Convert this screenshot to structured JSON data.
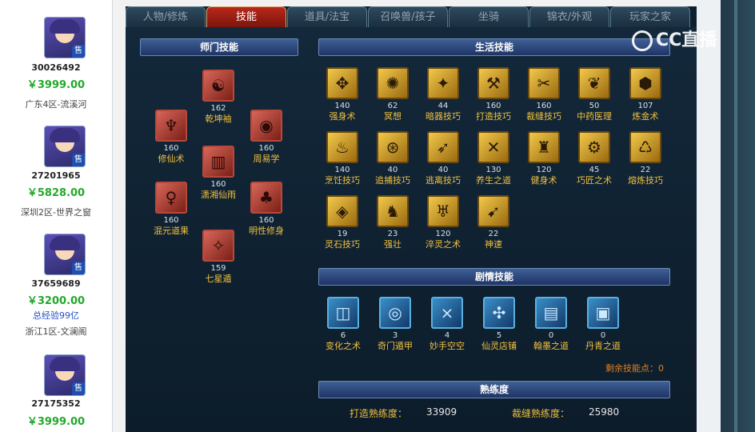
{
  "sidebar": {
    "listings": [
      {
        "id": "30026492",
        "price": "￥3999.00",
        "note": "",
        "server": "广东4区-流溪河",
        "tag": "售"
      },
      {
        "id": "27201965",
        "price": "￥5828.00",
        "note": "",
        "server": "深圳2区-世界之窗",
        "tag": "售"
      },
      {
        "id": "37659689",
        "price": "￥3200.00",
        "note": "总经验99亿",
        "server": "浙江1区-文澜阁",
        "tag": "售"
      },
      {
        "id": "27175352",
        "price": "￥3999.00",
        "note": "",
        "server": "",
        "tag": "售"
      }
    ]
  },
  "tabs": [
    "人物/修炼",
    "技能",
    "道具/法宝",
    "召唤兽/孩子",
    "坐骑",
    "锦衣/外观",
    "玩家之家"
  ],
  "active_tab": "技能",
  "sections": {
    "master": "师门技能",
    "life": "生活技能",
    "plot": "剧情技能",
    "proficiency": "熟练度"
  },
  "master_skills": [
    {
      "name": "乾坤袖",
      "level": "162",
      "glyph": "☯"
    },
    {
      "name": "修仙术",
      "level": "160",
      "glyph": "♆"
    },
    {
      "name": "周易学",
      "level": "160",
      "glyph": "◉"
    },
    {
      "name": "潇湘仙雨",
      "level": "160",
      "glyph": "▥"
    },
    {
      "name": "混元道果",
      "level": "160",
      "glyph": "♀"
    },
    {
      "name": "明性修身",
      "level": "160",
      "glyph": "♣"
    },
    {
      "name": "七星遁",
      "level": "159",
      "glyph": "✧"
    }
  ],
  "life_skills": [
    {
      "name": "强身术",
      "level": "140",
      "glyph": "✥"
    },
    {
      "name": "冥想",
      "level": "62",
      "glyph": "✺"
    },
    {
      "name": "暗器技巧",
      "level": "44",
      "glyph": "✦"
    },
    {
      "name": "打造技巧",
      "level": "160",
      "glyph": "⚒"
    },
    {
      "name": "裁缝技巧",
      "level": "160",
      "glyph": "✂"
    },
    {
      "name": "中药医理",
      "level": "50",
      "glyph": "❦"
    },
    {
      "name": "炼金术",
      "level": "107",
      "glyph": "⬢"
    },
    {
      "name": "烹饪技巧",
      "level": "140",
      "glyph": "♨"
    },
    {
      "name": "追捕技巧",
      "level": "40",
      "glyph": "⊛"
    },
    {
      "name": "逃离技巧",
      "level": "40",
      "glyph": "➶"
    },
    {
      "name": "养生之道",
      "level": "130",
      "glyph": "✕"
    },
    {
      "name": "健身术",
      "level": "120",
      "glyph": "♜"
    },
    {
      "name": "巧匠之术",
      "level": "45",
      "glyph": "⚙"
    },
    {
      "name": "熔炼技巧",
      "level": "22",
      "glyph": "♺"
    },
    {
      "name": "灵石技巧",
      "level": "19",
      "glyph": "◈"
    },
    {
      "name": "强壮",
      "level": "23",
      "glyph": "♞"
    },
    {
      "name": "淬灵之术",
      "level": "120",
      "glyph": "♅"
    },
    {
      "name": "神速",
      "level": "22",
      "glyph": "➹"
    }
  ],
  "plot_skills": [
    {
      "name": "变化之术",
      "level": "6",
      "glyph": "◫"
    },
    {
      "name": "奇门遁甲",
      "level": "3",
      "glyph": "◎"
    },
    {
      "name": "妙手空空",
      "level": "4",
      "glyph": "⨯"
    },
    {
      "name": "仙灵店铺",
      "level": "5",
      "glyph": "✣"
    },
    {
      "name": "翰墨之道",
      "level": "0",
      "glyph": "▤"
    },
    {
      "name": "丹青之道",
      "level": "0",
      "glyph": "▣"
    }
  ],
  "remaining_points": "剩余技能点：0",
  "proficiency": {
    "forge_label": "打造熟练度：",
    "forge_value": "33909",
    "tailor_label": "裁缝熟练度：",
    "tailor_value": "25980"
  },
  "watermark": "CC直播"
}
